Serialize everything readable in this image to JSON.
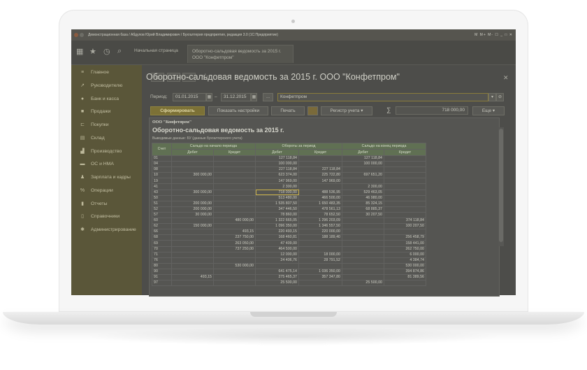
{
  "window": {
    "title": "Демонстрационная база / Абдулов Юрий Владимирович / Бухгалтерия предприятия, редакция 3.0 (1С:Предприятие)",
    "controls": "M M+ M- ☐ _ □ ✕"
  },
  "topbar": {
    "tabs": [
      {
        "label": "Начальная страница"
      },
      {
        "label": "Оборотно-сальдовая ведомость за 2015 г. ООО \"Конфетпром\""
      }
    ]
  },
  "sidebar": {
    "items": [
      {
        "label": "Главное",
        "icon": "menu-icon"
      },
      {
        "label": "Руководителю",
        "icon": "chart-trend-icon"
      },
      {
        "label": "Банк и касса",
        "icon": "bank-icon"
      },
      {
        "label": "Продажи",
        "icon": "bag-icon"
      },
      {
        "label": "Покупки",
        "icon": "cart-icon"
      },
      {
        "label": "Склад",
        "icon": "warehouse-icon"
      },
      {
        "label": "Производство",
        "icon": "factory-icon"
      },
      {
        "label": "ОС и НМА",
        "icon": "truck-icon"
      },
      {
        "label": "Зарплата и кадры",
        "icon": "person-icon"
      },
      {
        "label": "Операции",
        "icon": "operations-icon"
      },
      {
        "label": "Отчеты",
        "icon": "bar-chart-icon"
      },
      {
        "label": "Справочники",
        "icon": "book-icon"
      },
      {
        "label": "Администрирование",
        "icon": "gear-icon"
      }
    ]
  },
  "report": {
    "title": "Оборотно-сальдовая ведомость за 2015 г. ООО \"Конфетпром\"",
    "period_label": "Период:",
    "date_from": "01.01.2015",
    "date_to": "31.12.2015",
    "dash": "–",
    "ellipsis": "...",
    "organization": "Конфетпром",
    "buttons": {
      "generate": "Сформировать",
      "settings": "Показать настройки",
      "print": "Печать",
      "register": "Регистр учета",
      "more": "Еще"
    },
    "sum_symbol": "∑",
    "sum_value": "718 000,00"
  },
  "sheet": {
    "org": "ООО \"Конфетпром\"",
    "title": "Оборотно-сальдовая ведомость за 2015 г.",
    "note": "Выводимые данные:   БУ (данные бухгалтерского учета)",
    "headers": {
      "account": "Счет",
      "opening": "Сальдо на начало периода",
      "turnover": "Обороты за период",
      "closing": "Сальдо на конец периода",
      "debit": "Дебет",
      "credit": "Кредит"
    },
    "rows": [
      [
        "01",
        "",
        "",
        "127 118,84",
        "",
        "127 118,84",
        ""
      ],
      [
        "04",
        "",
        "",
        "100 000,00",
        "",
        "100 000,00",
        ""
      ],
      [
        "08",
        "",
        "",
        "227 118,84",
        "227 118,84",
        "",
        ""
      ],
      [
        "10",
        "300 000,00",
        "",
        "623 374,00",
        "225 722,80",
        "697 651,20",
        ""
      ],
      [
        "19",
        "",
        "",
        "147 969,00",
        "147 969,00",
        "",
        ""
      ],
      [
        "41",
        "",
        "",
        "2 300,00",
        "",
        "2 300,00",
        ""
      ],
      [
        "43",
        "300 000,00",
        "",
        "718 000,00",
        "488 536,95",
        "529 463,05",
        ""
      ],
      [
        "50",
        "",
        "",
        "513 480,00",
        "466 500,00",
        "46 980,00",
        ""
      ],
      [
        "51",
        "200 000,00",
        "",
        "1 535 807,50",
        "1 650 483,35",
        "85 324,15",
        ""
      ],
      [
        "52",
        "200 000,00",
        "",
        "347 446,50",
        "478 561,13",
        "68 885,37",
        ""
      ],
      [
        "57",
        "30 000,00",
        "",
        "78 860,00",
        "78 652,50",
        "30 207,50",
        ""
      ],
      [
        "60",
        "",
        "480 000,00",
        "1 322 665,05",
        "1 296 203,09",
        "",
        "374 118,84"
      ],
      [
        "62",
        "150 000,00",
        "",
        "1 096 350,00",
        "1 346 557,50",
        "",
        "100 207,50"
      ],
      [
        "66",
        "",
        "493,15",
        "220 493,15",
        "220 000,00",
        "",
        ""
      ],
      [
        "68",
        "",
        "237 750,00",
        "168 460,81",
        "188 189,40",
        "",
        "256 458,79"
      ],
      [
        "69",
        "",
        "263 050,00",
        "47 409,00",
        "",
        "",
        "158 441,00"
      ],
      [
        "70",
        "",
        "737 250,00",
        "464 500,00",
        "",
        "",
        "262 750,00"
      ],
      [
        "71",
        "",
        "",
        "12 000,00",
        "18 000,00",
        "",
        "6 000,00"
      ],
      [
        "76",
        "",
        "",
        "24 406,76",
        "28 791,52",
        "",
        "4 384,74"
      ],
      [
        "80",
        "",
        "530 000,00",
        "",
        "",
        "",
        "530 000,00"
      ],
      [
        "90",
        "",
        "",
        "641 475,14",
        "1 036 350,00",
        "",
        "394 874,86"
      ],
      [
        "91",
        "493,15",
        "",
        "275 465,37",
        "357 347,80",
        "",
        "81 389,56"
      ],
      [
        "97",
        "",
        "",
        "25 500,00",
        "",
        "25 500,00",
        ""
      ]
    ]
  }
}
